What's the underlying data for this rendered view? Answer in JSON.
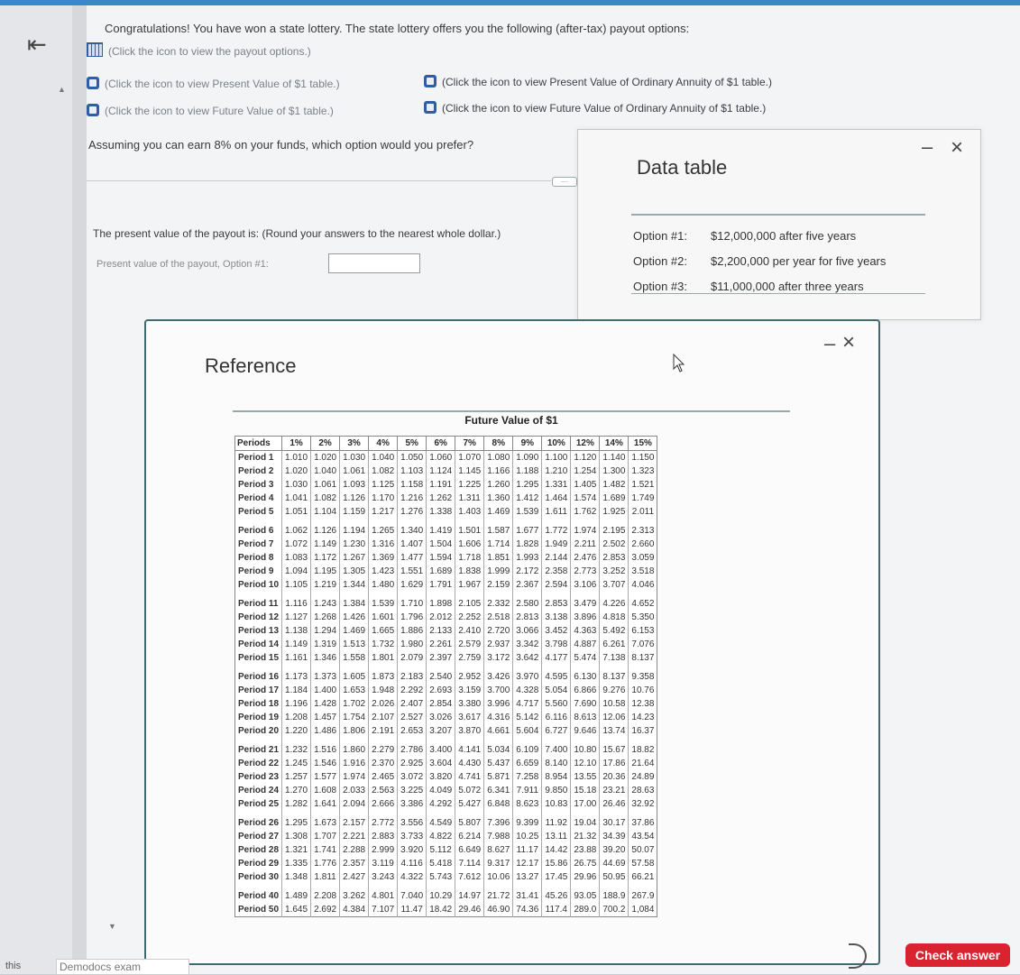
{
  "nav": {
    "back_glyph": "⇤",
    "back_icon": "back-arrow-icon"
  },
  "question": {
    "intro": "Congratulations! You have won a state lottery. The state lottery offers you the following (after-tax) payout options:",
    "payout_link": "(Click the icon to view the payout options.)",
    "pv_link": "(Click the icon to view Present Value of $1 table.)",
    "fv_link": "(Click the icon to view Future Value of $1 table.)",
    "pvoa_link": "(Click the icon to view Present Value of Ordinary Annuity of $1 table.)",
    "fvoa_link": "(Click the icon to view Future Value of Ordinary Annuity of $1 table.)",
    "prompt": "Assuming you can earn 8% on your funds, which option would you prefer?",
    "dots_label": "....",
    "instruction": "The present value of the payout is: (Round your answers to the nearest whole dollar.)",
    "answer_label": "Present value of the payout, Option #1:",
    "answer_value": ""
  },
  "data_table": {
    "title": "Data table",
    "minimize": "–",
    "close": "×",
    "options": [
      {
        "label": "Option #1:",
        "value": "$12,000,000 after five years"
      },
      {
        "label": "Option #2:",
        "value": "$2,200,000 per year for five years"
      },
      {
        "label": "Option #3:",
        "value": "$11,000,000 after three years"
      }
    ]
  },
  "reference": {
    "title": "Reference",
    "minimize": "–",
    "close": "×",
    "table_title": "Future Value of $1",
    "headers": [
      "Periods",
      "1%",
      "2%",
      "3%",
      "4%",
      "5%",
      "6%",
      "7%",
      "8%",
      "9%",
      "10%",
      "12%",
      "14%",
      "15%"
    ],
    "rows": [
      [
        "Period 1",
        "1.010",
        "1.020",
        "1.030",
        "1.040",
        "1.050",
        "1.060",
        "1.070",
        "1.080",
        "1.090",
        "1.100",
        "1.120",
        "1.140",
        "1.150"
      ],
      [
        "Period 2",
        "1.020",
        "1.040",
        "1.061",
        "1.082",
        "1.103",
        "1.124",
        "1.145",
        "1.166",
        "1.188",
        "1.210",
        "1.254",
        "1.300",
        "1.323"
      ],
      [
        "Period 3",
        "1.030",
        "1.061",
        "1.093",
        "1.125",
        "1.158",
        "1.191",
        "1.225",
        "1.260",
        "1.295",
        "1.331",
        "1.405",
        "1.482",
        "1.521"
      ],
      [
        "Period 4",
        "1.041",
        "1.082",
        "1.126",
        "1.170",
        "1.216",
        "1.262",
        "1.311",
        "1.360",
        "1.412",
        "1.464",
        "1.574",
        "1.689",
        "1.749"
      ],
      [
        "Period 5",
        "1.051",
        "1.104",
        "1.159",
        "1.217",
        "1.276",
        "1.338",
        "1.403",
        "1.469",
        "1.539",
        "1.611",
        "1.762",
        "1.925",
        "2.011"
      ],
      [
        "Period 6",
        "1.062",
        "1.126",
        "1.194",
        "1.265",
        "1.340",
        "1.419",
        "1.501",
        "1.587",
        "1.677",
        "1.772",
        "1.974",
        "2.195",
        "2.313"
      ],
      [
        "Period 7",
        "1.072",
        "1.149",
        "1.230",
        "1.316",
        "1.407",
        "1.504",
        "1.606",
        "1.714",
        "1.828",
        "1.949",
        "2.211",
        "2.502",
        "2.660"
      ],
      [
        "Period 8",
        "1.083",
        "1.172",
        "1.267",
        "1.369",
        "1.477",
        "1.594",
        "1.718",
        "1.851",
        "1.993",
        "2.144",
        "2.476",
        "2.853",
        "3.059"
      ],
      [
        "Period 9",
        "1.094",
        "1.195",
        "1.305",
        "1.423",
        "1.551",
        "1.689",
        "1.838",
        "1.999",
        "2.172",
        "2.358",
        "2.773",
        "3.252",
        "3.518"
      ],
      [
        "Period 10",
        "1.105",
        "1.219",
        "1.344",
        "1.480",
        "1.629",
        "1.791",
        "1.967",
        "2.159",
        "2.367",
        "2.594",
        "3.106",
        "3.707",
        "4.046"
      ],
      [
        "Period 11",
        "1.116",
        "1.243",
        "1.384",
        "1.539",
        "1.710",
        "1.898",
        "2.105",
        "2.332",
        "2.580",
        "2.853",
        "3.479",
        "4.226",
        "4.652"
      ],
      [
        "Period 12",
        "1.127",
        "1.268",
        "1.426",
        "1.601",
        "1.796",
        "2.012",
        "2.252",
        "2.518",
        "2.813",
        "3.138",
        "3.896",
        "4.818",
        "5.350"
      ],
      [
        "Period 13",
        "1.138",
        "1.294",
        "1.469",
        "1.665",
        "1.886",
        "2.133",
        "2.410",
        "2.720",
        "3.066",
        "3.452",
        "4.363",
        "5.492",
        "6.153"
      ],
      [
        "Period 14",
        "1.149",
        "1.319",
        "1.513",
        "1.732",
        "1.980",
        "2.261",
        "2.579",
        "2.937",
        "3.342",
        "3.798",
        "4.887",
        "6.261",
        "7.076"
      ],
      [
        "Period 15",
        "1.161",
        "1.346",
        "1.558",
        "1.801",
        "2.079",
        "2.397",
        "2.759",
        "3.172",
        "3.642",
        "4.177",
        "5.474",
        "7.138",
        "8.137"
      ],
      [
        "Period 16",
        "1.173",
        "1.373",
        "1.605",
        "1.873",
        "2.183",
        "2.540",
        "2.952",
        "3.426",
        "3.970",
        "4.595",
        "6.130",
        "8.137",
        "9.358"
      ],
      [
        "Period 17",
        "1.184",
        "1.400",
        "1.653",
        "1.948",
        "2.292",
        "2.693",
        "3.159",
        "3.700",
        "4.328",
        "5.054",
        "6.866",
        "9.276",
        "10.76"
      ],
      [
        "Period 18",
        "1.196",
        "1.428",
        "1.702",
        "2.026",
        "2.407",
        "2.854",
        "3.380",
        "3.996",
        "4.717",
        "5.560",
        "7.690",
        "10.58",
        "12.38"
      ],
      [
        "Period 19",
        "1.208",
        "1.457",
        "1.754",
        "2.107",
        "2.527",
        "3.026",
        "3.617",
        "4.316",
        "5.142",
        "6.116",
        "8.613",
        "12.06",
        "14.23"
      ],
      [
        "Period 20",
        "1.220",
        "1.486",
        "1.806",
        "2.191",
        "2.653",
        "3.207",
        "3.870",
        "4.661",
        "5.604",
        "6.727",
        "9.646",
        "13.74",
        "16.37"
      ],
      [
        "Period 21",
        "1.232",
        "1.516",
        "1.860",
        "2.279",
        "2.786",
        "3.400",
        "4.141",
        "5.034",
        "6.109",
        "7.400",
        "10.80",
        "15.67",
        "18.82"
      ],
      [
        "Period 22",
        "1.245",
        "1.546",
        "1.916",
        "2.370",
        "2.925",
        "3.604",
        "4.430",
        "5.437",
        "6.659",
        "8.140",
        "12.10",
        "17.86",
        "21.64"
      ],
      [
        "Period 23",
        "1.257",
        "1.577",
        "1.974",
        "2.465",
        "3.072",
        "3.820",
        "4.741",
        "5.871",
        "7.258",
        "8.954",
        "13.55",
        "20.36",
        "24.89"
      ],
      [
        "Period 24",
        "1.270",
        "1.608",
        "2.033",
        "2.563",
        "3.225",
        "4.049",
        "5.072",
        "6.341",
        "7.911",
        "9.850",
        "15.18",
        "23.21",
        "28.63"
      ],
      [
        "Period 25",
        "1.282",
        "1.641",
        "2.094",
        "2.666",
        "3.386",
        "4.292",
        "5.427",
        "6.848",
        "8.623",
        "10.83",
        "17.00",
        "26.46",
        "32.92"
      ],
      [
        "Period 26",
        "1.295",
        "1.673",
        "2.157",
        "2.772",
        "3.556",
        "4.549",
        "5.807",
        "7.396",
        "9.399",
        "11.92",
        "19.04",
        "30.17",
        "37.86"
      ],
      [
        "Period 27",
        "1.308",
        "1.707",
        "2.221",
        "2.883",
        "3.733",
        "4.822",
        "6.214",
        "7.988",
        "10.25",
        "13.11",
        "21.32",
        "34.39",
        "43.54"
      ],
      [
        "Period 28",
        "1.321",
        "1.741",
        "2.288",
        "2.999",
        "3.920",
        "5.112",
        "6.649",
        "8.627",
        "11.17",
        "14.42",
        "23.88",
        "39.20",
        "50.07"
      ],
      [
        "Period 29",
        "1.335",
        "1.776",
        "2.357",
        "3.119",
        "4.116",
        "5.418",
        "7.114",
        "9.317",
        "12.17",
        "15.86",
        "26.75",
        "44.69",
        "57.58"
      ],
      [
        "Period 30",
        "1.348",
        "1.811",
        "2.427",
        "3.243",
        "4.322",
        "5.743",
        "7.612",
        "10.06",
        "13.27",
        "17.45",
        "29.96",
        "50.95",
        "66.21"
      ],
      [
        "Period 40",
        "1.489",
        "2.208",
        "3.262",
        "4.801",
        "7.040",
        "10.29",
        "14.97",
        "21.72",
        "31.41",
        "45.26",
        "93.05",
        "188.9",
        "267.9"
      ],
      [
        "Period 50",
        "1.645",
        "2.692",
        "4.384",
        "7.107",
        "11.47",
        "18.42",
        "29.46",
        "46.90",
        "74.36",
        "117.4",
        "289.0",
        "700.2",
        "1,084"
      ]
    ]
  },
  "footer": {
    "left": "this",
    "name": "Demodocs exam",
    "check_answer": "Check answer"
  },
  "colors": {
    "accent": "#3b87c8",
    "button": "#d9232f",
    "popup_border": "#3f6b70"
  }
}
